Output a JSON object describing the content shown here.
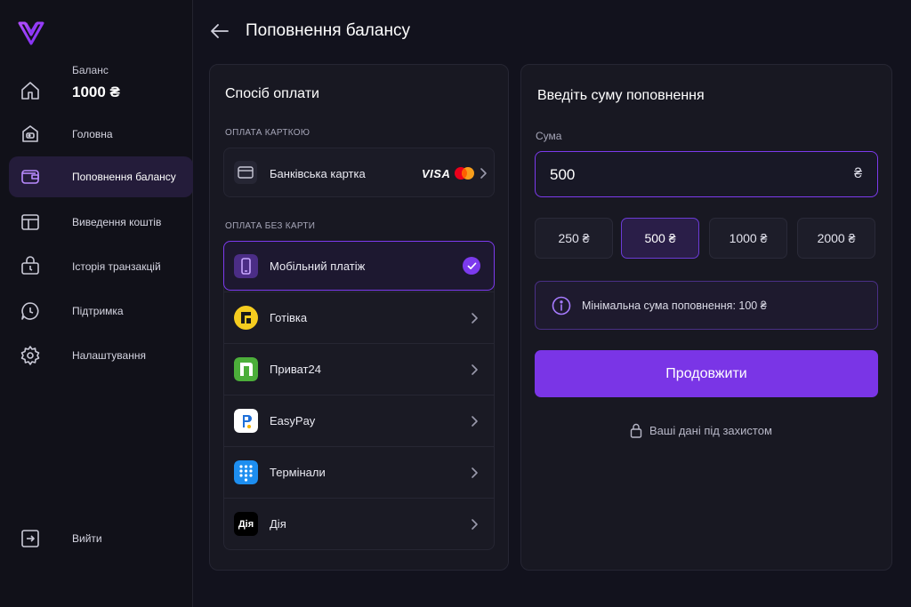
{
  "sidebar": {
    "balance_label": "Баланс",
    "balance_value": "1000 ₴",
    "items": [
      {
        "label": "Головна",
        "icon": "wallet-icon"
      },
      {
        "label": "Поповнення балансу",
        "icon": "wallet-card-icon",
        "active": true
      },
      {
        "label": "Виведення коштів",
        "icon": "withdraw-icon"
      },
      {
        "label": "Історія транзакцій",
        "icon": "history-icon"
      },
      {
        "label": "Підтримка",
        "icon": "support-icon"
      },
      {
        "label": "Налаштування",
        "icon": "gear-icon"
      }
    ],
    "logout_label": "Вийти"
  },
  "header": {
    "title": "Поповнення балансу"
  },
  "payment": {
    "title": "Спосіб оплати",
    "card_section": "ОПЛАТА КАРТКОЮ",
    "card_label": "Банківська картка",
    "visa": "VISA",
    "no_card_section": "ОПЛАТА БЕЗ КАРТИ",
    "methods": [
      {
        "label": "Мобільний платіж",
        "selected": true
      },
      {
        "label": "Готівка"
      },
      {
        "label": "Приват24"
      },
      {
        "label": "EasyPay"
      },
      {
        "label": "Термінали"
      },
      {
        "label": "Дія"
      }
    ],
    "diia_logo_text": "Дія"
  },
  "amount": {
    "title": "Введіть суму поповнення",
    "field_label": "Сума",
    "value": "500",
    "currency": "₴",
    "presets": [
      "250 ₴",
      "500 ₴",
      "1000 ₴",
      "2000 ₴"
    ],
    "selected_preset": "500 ₴",
    "info": "Мінімальна сума поповнення: 100 ₴",
    "continue_label": "Продовжити",
    "secure_text": "Ваші дані під захистом"
  },
  "colors": {
    "accent": "#7a35e6",
    "background": "#12121d",
    "panel": "#181822"
  }
}
